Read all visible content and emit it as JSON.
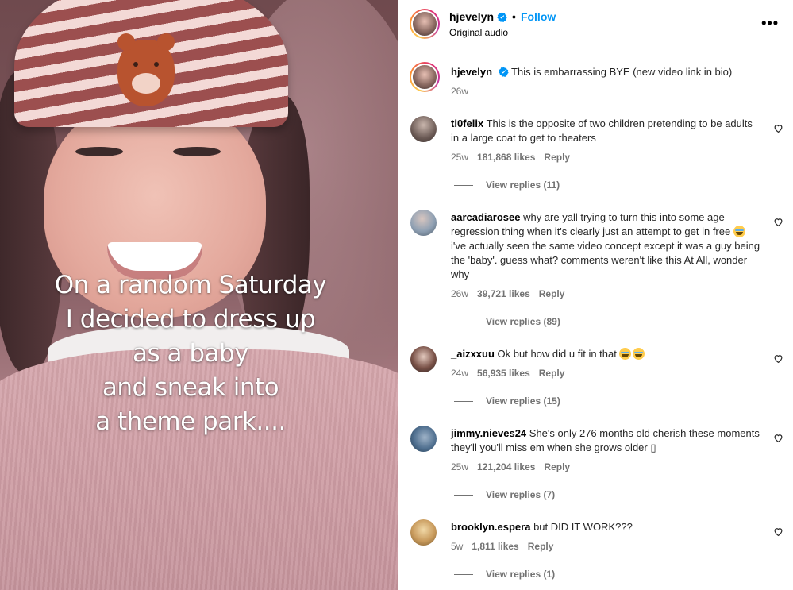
{
  "caption_lines": [
    "On a random Saturday",
    "I decided to dress up",
    "as a baby",
    "and sneak into",
    "a theme park...."
  ],
  "header": {
    "username": "hjevelyn",
    "follow_label": "Follow",
    "audio": "Original audio",
    "more_glyph": "•••"
  },
  "post": {
    "username": "hjevelyn",
    "text": "This is embarrassing BYE (new video link in bio)",
    "time": "26w"
  },
  "comments": [
    {
      "username": "ti0felix",
      "text": "This is the opposite of two children pretending to be adults in a large coat to get to theaters",
      "time": "25w",
      "likes": "181,868 likes",
      "reply_label": "Reply",
      "view_replies": "View replies (11)"
    },
    {
      "username": "aarcadiarosee",
      "text": "why are yall trying to turn this into some age regression thing when it's clearly just an attempt to get in free",
      "text_2": "i've actually seen the same video concept except it was a guy being the 'baby'. guess what? comments weren't like this At All, wonder why",
      "time": "26w",
      "likes": "39,721 likes",
      "reply_label": "Reply",
      "view_replies": "View replies (89)"
    },
    {
      "username": "_aizxxuu",
      "text": "Ok but how did u fit in that",
      "time": "24w",
      "likes": "56,935 likes",
      "reply_label": "Reply",
      "view_replies": "View replies (15)"
    },
    {
      "username": "jimmy.nieves24",
      "text": "She's only 276 months old cherish these moments they'll you'll miss em when she grows older ▯",
      "time": "25w",
      "likes": "121,204 likes",
      "reply_label": "Reply",
      "view_replies": "View replies (7)"
    },
    {
      "username": "brooklyn.espera",
      "text": "but DID IT WORK???",
      "time": "5w",
      "likes": "1,811 likes",
      "reply_label": "Reply",
      "view_replies": "View replies (1)"
    }
  ],
  "colors": {
    "link": "#0095f6",
    "muted": "#737373",
    "verified": "#0095f6"
  }
}
